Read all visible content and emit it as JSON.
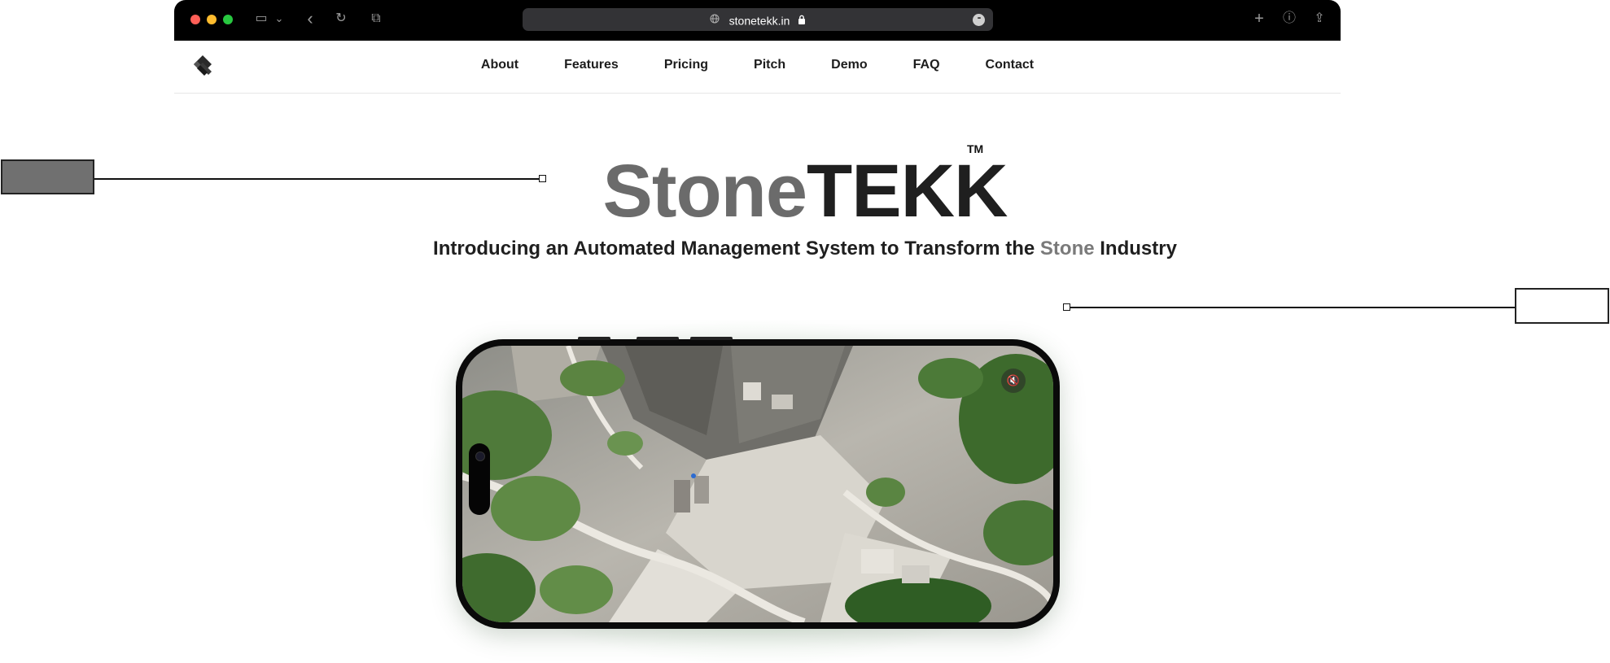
{
  "browser": {
    "url": "stonetekk.in",
    "icons": [
      "close-dot",
      "minimize-dot",
      "maximize-dot",
      "sidebar-icon",
      "chevron-down-icon",
      "back-icon",
      "reload-icon",
      "tabs-icon",
      "globe-icon",
      "lock-icon",
      "more-icon",
      "new-tab-icon",
      "info-icon",
      "share-icon"
    ],
    "controls": {
      "sidebar": "▭",
      "chevron": "⌄",
      "back": "‹",
      "reload": "↻",
      "tabs": "⧉",
      "more": "•••",
      "new_tab": "+",
      "info": "ⓘ",
      "share": "⇪"
    }
  },
  "nav": {
    "items": [
      "About",
      "Features",
      "Pricing",
      "Pitch",
      "Demo",
      "FAQ",
      "Contact"
    ]
  },
  "hero": {
    "title_part1": "Stone",
    "title_part2": "TEKK",
    "trademark": "TM",
    "subtitle_before": "Introducing an Automated Management System to Transform the ",
    "subtitle_accent": "Stone",
    "subtitle_after": " Industry"
  },
  "colors": {
    "title_grey": "#6b6b6b",
    "title_dark": "#1f1f1f",
    "accent_grey": "#7a7a7a",
    "chrome_bg": "#000000"
  },
  "video": {
    "muted_icon": "speaker-muted-icon",
    "mute_symbol": "🔇"
  }
}
